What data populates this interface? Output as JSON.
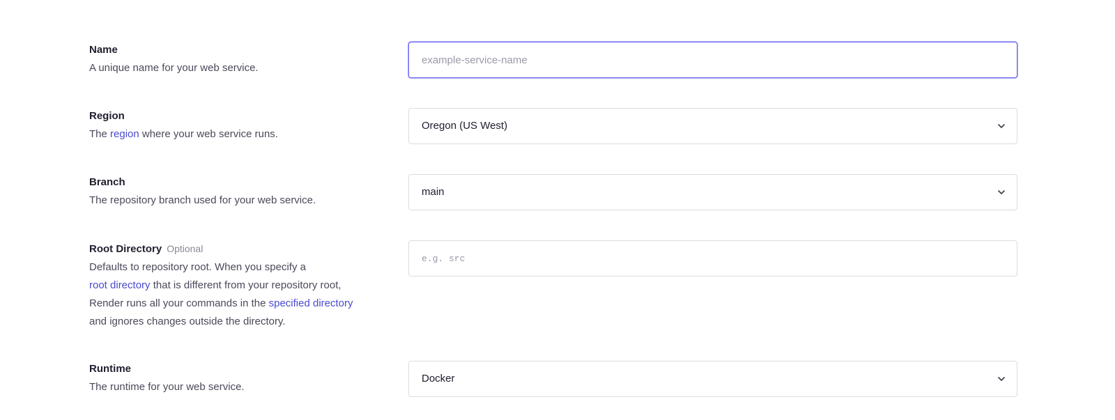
{
  "fields": {
    "name": {
      "title": "Name",
      "description": "A unique name for your web service.",
      "value": "",
      "placeholder": "example-service-name"
    },
    "region": {
      "title": "Region",
      "desc_before": "The ",
      "desc_link": "region",
      "desc_after": " where your web service runs.",
      "selected": "Oregon (US West)"
    },
    "branch": {
      "title": "Branch",
      "description": "The repository branch used for your web service.",
      "selected": "main"
    },
    "root_directory": {
      "title": "Root Directory",
      "optional_label": "Optional",
      "desc_line1": "Defaults to repository root. When you specify a",
      "desc_link1": "root directory",
      "desc_mid": " that is different from your repository root,",
      "desc_line3_before": "Render runs all your commands in the ",
      "desc_link2": "specified directory",
      "desc_line4": "and ignores changes outside the directory.",
      "value": "",
      "placeholder": "e.g. src"
    },
    "runtime": {
      "title": "Runtime",
      "description": "The runtime for your web service.",
      "selected": "Docker"
    }
  },
  "icons": {
    "select_chevron": "chevron-down-icon"
  },
  "colors": {
    "link": "#4a4ad0",
    "focus_border": "#6c6cf0",
    "border": "#dcdce3"
  }
}
